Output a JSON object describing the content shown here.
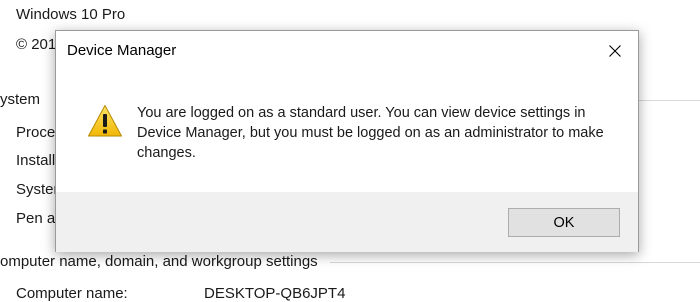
{
  "background": {
    "edition": "Windows 10 Pro",
    "copyright_partial": "© 201",
    "section_system": "ystem",
    "row_processor": "Proces",
    "row_installed": "Install",
    "row_system_type": "Syster",
    "row_pen": "Pen ar",
    "section_computer_name": "omputer name, domain, and workgroup settings",
    "computer_name_label": "Computer name:",
    "computer_name_value": "DESKTOP-QB6JPT4"
  },
  "dialog": {
    "title": "Device Manager",
    "icon": "warning-icon",
    "message": "You are logged on as a standard user. You can view device settings in Device Manager, but you must be logged on as an administrator to make changes.",
    "ok_label": "OK"
  }
}
